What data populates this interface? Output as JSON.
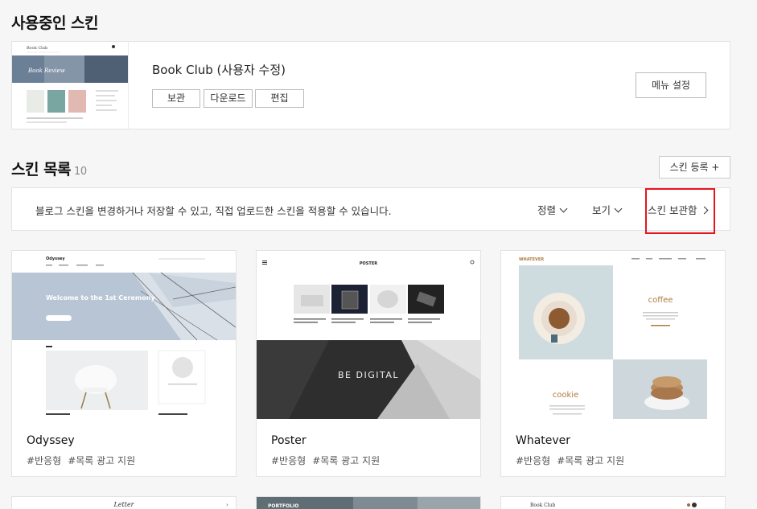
{
  "current": {
    "section_title": "사용중인 스킨",
    "name": "Book Club (사용자 수정)",
    "thumb_banner_text": "Book Review",
    "thumb_logo_text": "Book Club",
    "buttons": {
      "archive": "보관",
      "download": "다운로드",
      "edit": "편집"
    },
    "menu_settings": "메뉴 설정"
  },
  "list": {
    "title": "스킨 목록",
    "count": "10",
    "register": "스킨 등록 +",
    "info": "블로그 스킨을 변경하거나 저장할 수 있고, 직접 업로드한 스킨을 적용할 수 있습니다.",
    "sort": "정렬",
    "view": "보기",
    "archive_box": "스킨 보관함"
  },
  "skins": [
    {
      "name": "Odyssey",
      "tags": [
        "#반응형",
        "#목록 광고 지원"
      ],
      "logo": "Odyssey",
      "hero": "Welcome to the 1st Ceremony"
    },
    {
      "name": "Poster",
      "tags": [
        "#반응형",
        "#목록 광고 지원"
      ],
      "logo": "POSTER",
      "hero": "BE DIGITAL"
    },
    {
      "name": "Whatever",
      "tags": [
        "#반응형",
        "#목록 광고 지원"
      ],
      "logo": "WHATEVER",
      "hero": "coffee",
      "hero2": "cookie"
    }
  ],
  "bottom_row": {
    "card1_logo": "Letter",
    "card2_logo": "PORTFOLIO",
    "card3_logo": "Book Club"
  },
  "colors": {
    "accent_red": "#e8141c",
    "background": "#f6f6f6",
    "card_border": "#e3e3e3"
  }
}
